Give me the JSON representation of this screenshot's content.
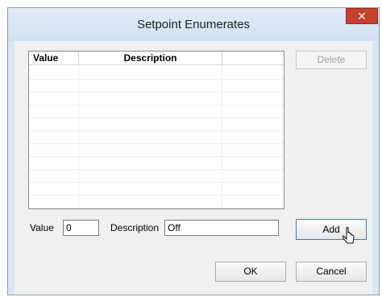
{
  "window": {
    "title": "Setpoint Enumerates",
    "close_glyph": "✕"
  },
  "list": {
    "columns": [
      "Value",
      "Description",
      ""
    ],
    "rows": []
  },
  "buttons": {
    "delete": "Delete",
    "add": "Add",
    "ok": "OK",
    "cancel": "Cancel"
  },
  "form": {
    "value_label": "Value",
    "value_field": "0",
    "description_label": "Description",
    "description_field": "Off"
  }
}
